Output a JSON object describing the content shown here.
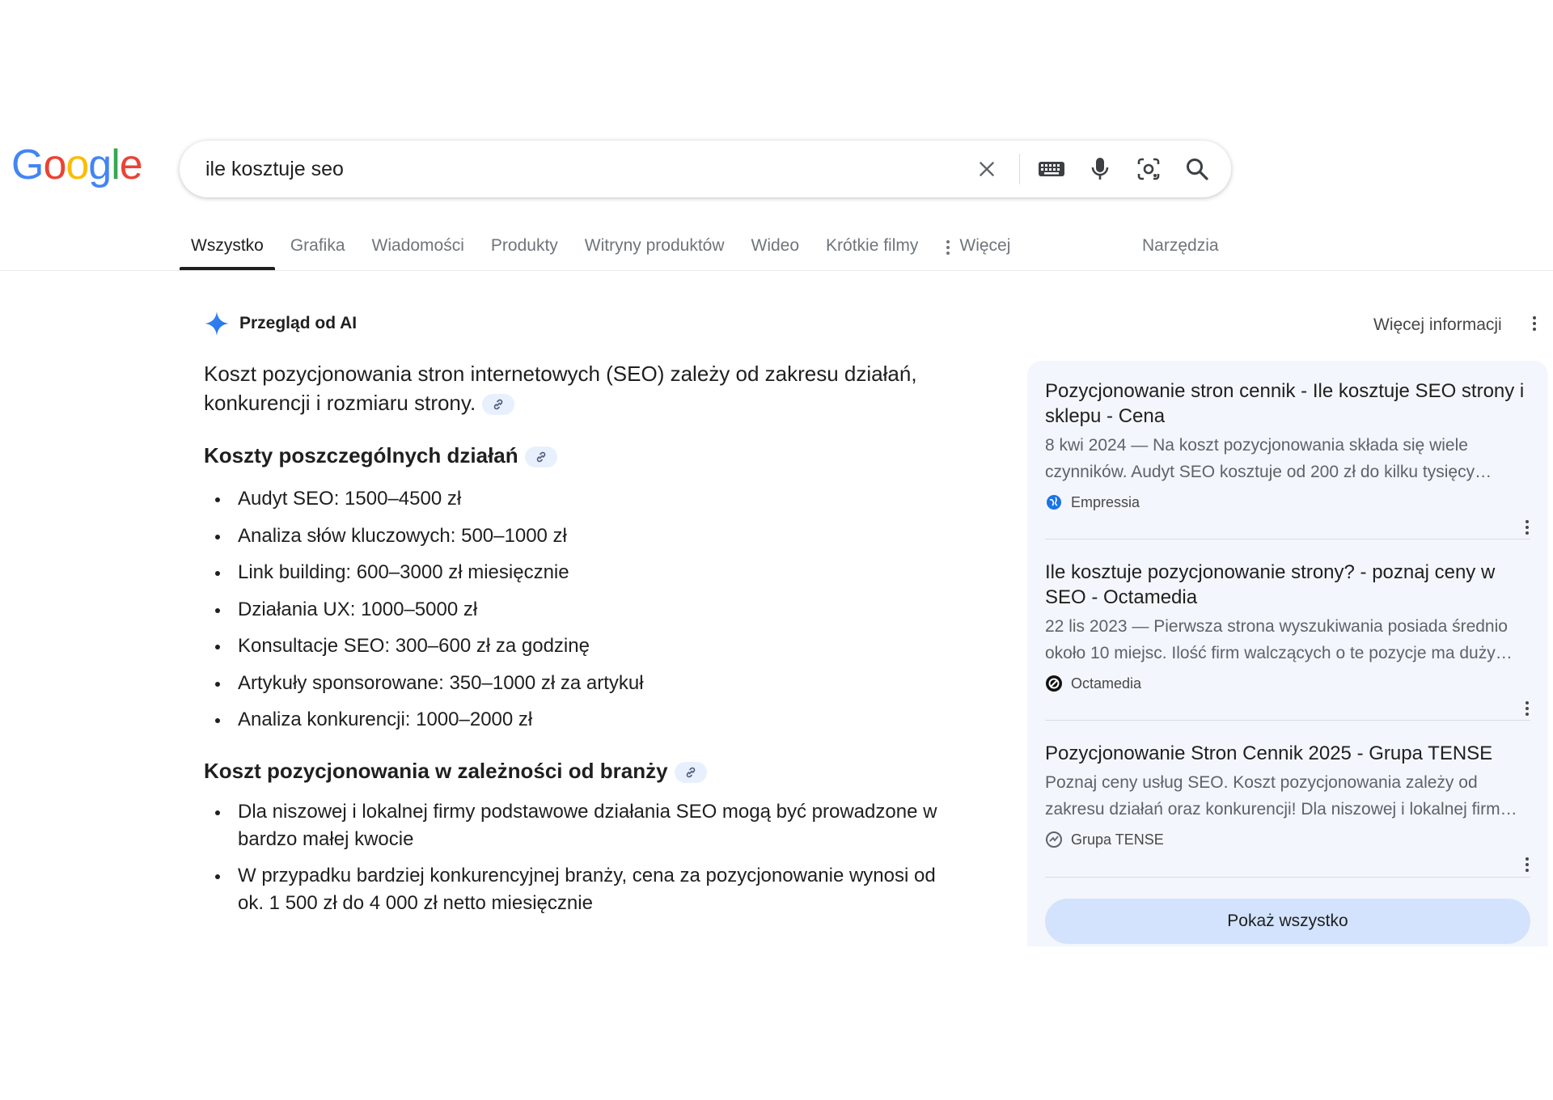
{
  "logo": {
    "text": "Google"
  },
  "search": {
    "query": "ile kosztuje seo",
    "placeholder": ""
  },
  "tabs": [
    {
      "label": "Wszystko",
      "active": true
    },
    {
      "label": "Grafika"
    },
    {
      "label": "Wiadomości"
    },
    {
      "label": "Produkty"
    },
    {
      "label": "Witryny produktów"
    },
    {
      "label": "Wideo"
    },
    {
      "label": "Krótkie filmy"
    },
    {
      "label": "Więcej"
    }
  ],
  "tools_label": "Narzędzia",
  "ai_overview": {
    "title": "Przegląd od AI",
    "more_info": "Więcej informacji",
    "intro": "Koszt pozycjonowania stron internetowych (SEO) zależy od zakresu działań, konkurencji i rozmiaru strony.",
    "section1": {
      "heading": "Koszty poszczególnych działań",
      "items": [
        "Audyt SEO: 1500–4500 zł",
        "Analiza słów kluczowych: 500–1000 zł",
        "Link building: 600–3000 zł miesięcznie",
        "Działania UX: 1000–5000 zł",
        "Konsultacje SEO: 300–600 zł za godzinę",
        "Artykuły sponsorowane: 350–1000 zł za artykuł",
        "Analiza konkurencji: 1000–2000 zł"
      ]
    },
    "section2": {
      "heading": "Koszt pozycjonowania w zależności od branży",
      "items": [
        "Dla niszowej i lokalnej firmy podstawowe działania SEO mogą być prowadzone w bardzo małej kwocie",
        "W przypadku bardziej konkurencyjnej branży, cena za pozycjonowanie wynosi od ok. 1 500 zł do 4 000 zł netto miesięcznie"
      ]
    }
  },
  "sources": [
    {
      "title": "Pozycjonowanie stron cennik - Ile kosztuje SEO strony i sklepu - Cena",
      "snippet": "8 kwi 2024 — Na koszt pozycjonowania składa się wiele czynników. Audyt SEO kosztuje od 200 zł do kilku tysięcy…",
      "site": "Empressia",
      "icon": "globe-icon"
    },
    {
      "title": "Ile kosztuje pozycjonowanie strony? - poznaj ceny w SEO - Octamedia",
      "snippet": "22 lis 2023 — Pierwsza strona wyszukiwania posiada średnio około 10 miejsc. Ilość firm walczących o te pozycje ma duży…",
      "site": "Octamedia",
      "icon": "octamedia-logo-icon"
    },
    {
      "title": "Pozycjonowanie Stron Cennik 2025 - Grupa TENSE",
      "snippet": "Poznaj ceny usług SEO. Koszt pozycjonowania zależy od zakresu działań oraz konkurencji! Dla niszowej i lokalnej firm…",
      "site": "Grupa TENSE",
      "icon": "tense-logo-icon"
    }
  ],
  "show_all_label": "Pokaż wszystko",
  "colors": {
    "google_blue": "#4285F4",
    "google_red": "#EA4335",
    "google_yellow": "#FBBC05",
    "google_green": "#34A853",
    "panel_bg": "#f3f6fc",
    "button_bg": "#d3e3fd"
  }
}
